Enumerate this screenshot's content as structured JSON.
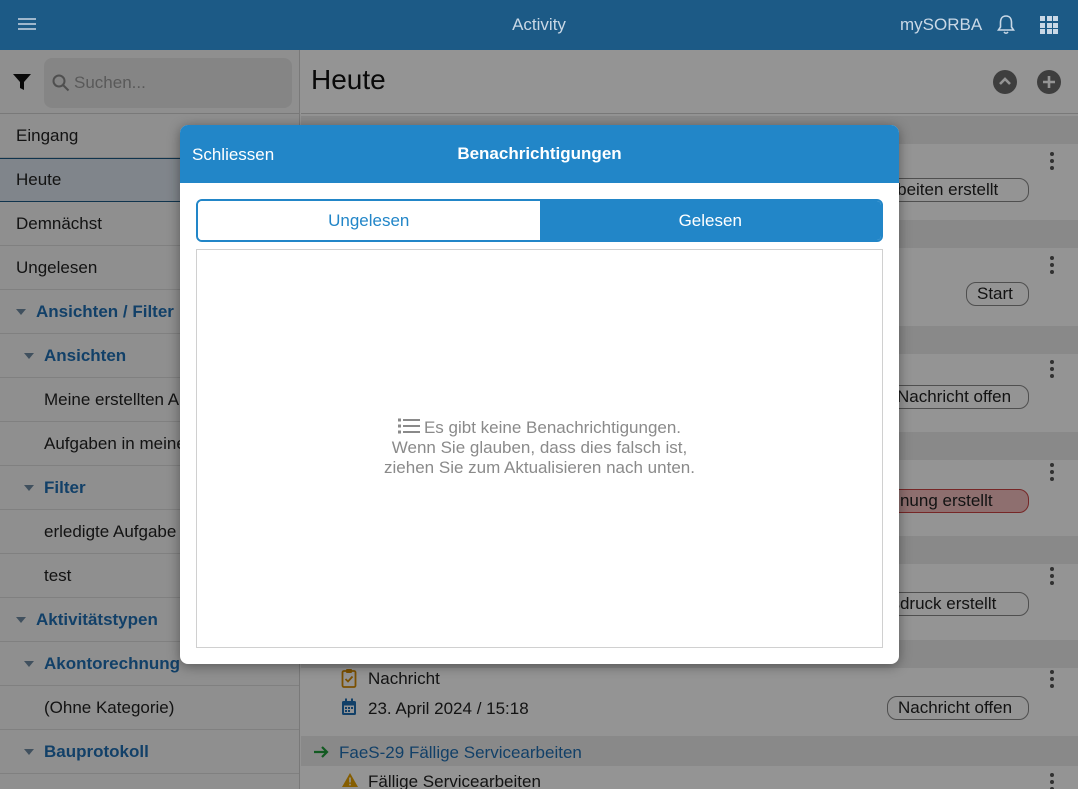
{
  "topbar": {
    "title": "Activity",
    "brand": "mySORBA"
  },
  "sidebar": {
    "search_placeholder": "Suchen...",
    "items": [
      {
        "label": "Eingang"
      },
      {
        "label": "Heute"
      },
      {
        "label": "Demnächst"
      },
      {
        "label": "Ungelesen"
      },
      {
        "label": "Ansichten / Filter"
      },
      {
        "label": "Ansichten"
      },
      {
        "label": "Meine erstellten A"
      },
      {
        "label": "Aufgaben in meine"
      },
      {
        "label": "Filter"
      },
      {
        "label": "erledigte Aufgabe"
      },
      {
        "label": "test"
      },
      {
        "label": "Aktivitätstypen"
      },
      {
        "label": "Akontorechnung"
      },
      {
        "label": "(Ohne Kategorie)"
      },
      {
        "label": "Bauprotokoll"
      }
    ]
  },
  "main": {
    "title": "Heute",
    "pills": [
      "arbeiten erstellt",
      "Start",
      "Nachricht offen",
      "chnung erstellt",
      "usdruck erstellt",
      "Nachricht offen"
    ],
    "rows": {
      "nachricht": "Nachricht",
      "date": "23. April 2024 / 15:18",
      "link_id": "FaeS-29",
      "link_text": "Fällige Servicearbeiten",
      "bottom_text": "Fällige Servicearbeiten"
    }
  },
  "modal": {
    "close_label": "Schliessen",
    "title": "Benachrichtigungen",
    "tabs": [
      {
        "label": "Ungelesen",
        "active": false
      },
      {
        "label": "Gelesen",
        "active": true
      }
    ],
    "empty_line1": "Es gibt keine Benachrichtigungen.",
    "empty_line2": "Wenn Sie glauben, dass dies falsch ist,",
    "empty_line3": "ziehen Sie zum Aktualisieren nach unten."
  },
  "colors": {
    "topbar": "#1c5a86",
    "accent": "#2286c8",
    "link": "#1f6fb3"
  }
}
